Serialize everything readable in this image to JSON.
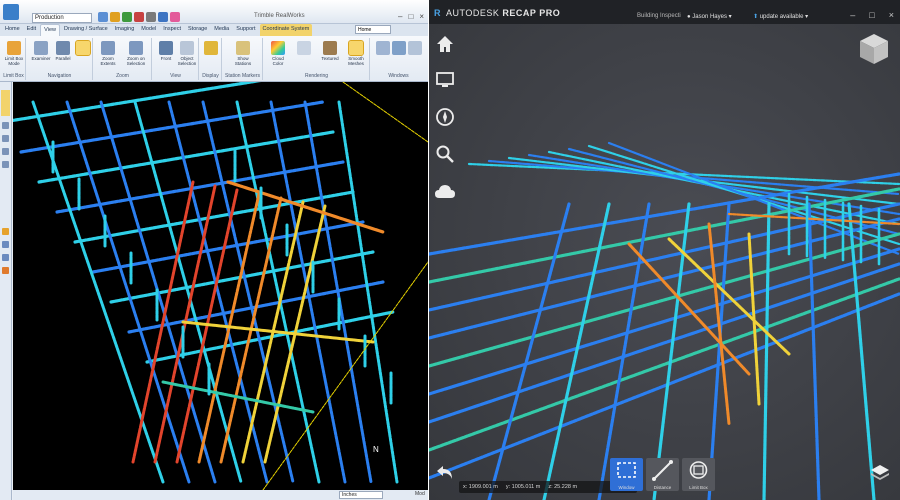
{
  "left_app": {
    "window_title": "Trimble RealWorks",
    "mode_select": "Production",
    "window_buttons": [
      "–",
      "□",
      "×"
    ],
    "tabs": [
      {
        "label": "Home",
        "state": "normal"
      },
      {
        "label": "Edit",
        "state": "normal"
      },
      {
        "label": "View",
        "state": "active"
      },
      {
        "label": "Drawing / Surface",
        "state": "normal"
      },
      {
        "label": "Imaging",
        "state": "normal"
      },
      {
        "label": "Model",
        "state": "normal"
      },
      {
        "label": "Inspect",
        "state": "normal"
      },
      {
        "label": "Storage",
        "state": "normal"
      },
      {
        "label": "Media",
        "state": "normal"
      },
      {
        "label": "Support",
        "state": "normal"
      },
      {
        "label": "Coordinate System",
        "state": "accent"
      }
    ],
    "search_box": "Home",
    "ribbon_groups": [
      {
        "label": "Limit Box",
        "tools": [
          "Limit Box Mode"
        ]
      },
      {
        "label": "Navigation",
        "tools": [
          "Examiner",
          "Parallel"
        ]
      },
      {
        "label": "Zoom",
        "tools": [
          "Zoom Extents",
          "Zoom on Selection"
        ]
      },
      {
        "label": "View",
        "tools": [
          "Front",
          "Object Selection"
        ]
      },
      {
        "label": "Display",
        "tools": []
      },
      {
        "label": "Station Markers",
        "tools": [
          "Show Stations"
        ]
      },
      {
        "label": "Rendering",
        "tools": [
          "Cloud Color",
          "Textured",
          "Smooth Meshes"
        ]
      },
      {
        "label": "Windows",
        "tools": []
      }
    ],
    "status_field": "Inches",
    "status_tag": "Mod"
  },
  "right_app": {
    "brand_prefix": "AUTODESK",
    "brand_name": "RECAP PRO",
    "project_name": "Building Inspecti",
    "user_name": "Jason Hayes",
    "update_label": "update available",
    "window_buttons": [
      "–",
      "□",
      "×"
    ],
    "side_icons": [
      "home-icon",
      "monitor-icon",
      "navigation-icon",
      "search-icon",
      "cloud-icon"
    ],
    "coords": {
      "x": "x: 1909.001 m",
      "y": "y: 1005.011 m",
      "z": "z: 25.228 m"
    },
    "bottom_tools": [
      {
        "label": "Window",
        "active": true
      },
      {
        "label": "Distance",
        "active": false
      },
      {
        "label": "Limit Box",
        "active": false
      }
    ],
    "colors": {
      "brand_blue": "#4aa3e6",
      "active_tool": "#2f6fd6",
      "titlebar": "#202226"
    }
  }
}
